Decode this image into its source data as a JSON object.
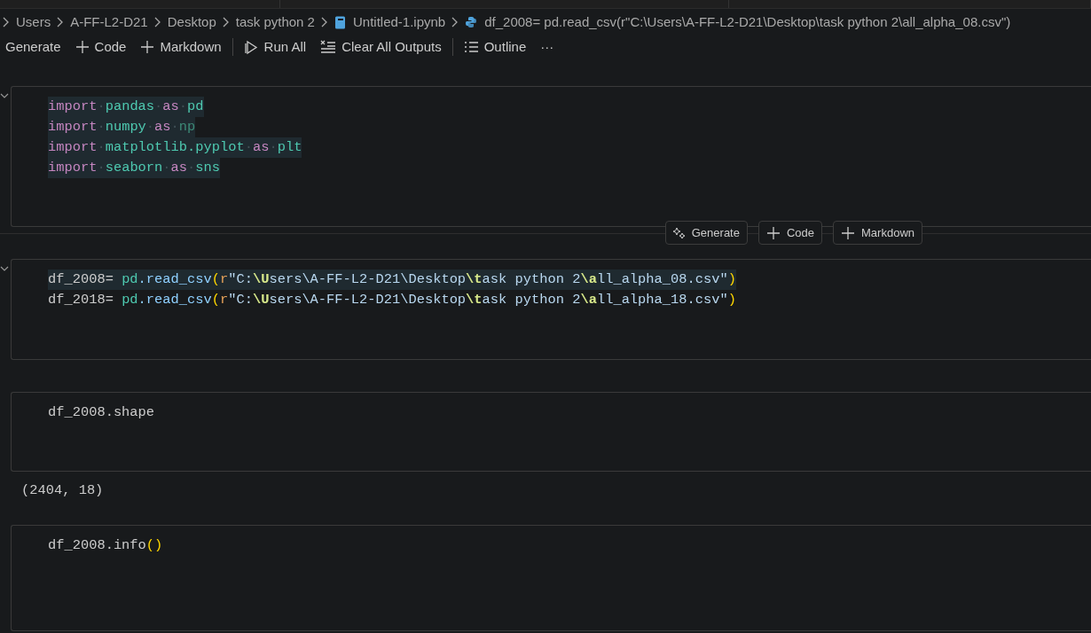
{
  "breadcrumb": [
    {
      "label": "Users"
    },
    {
      "label": "A-FF-L2-D21"
    },
    {
      "label": "Desktop"
    },
    {
      "label": "task python 2"
    },
    {
      "label": "Untitled-1.ipynb",
      "kind": "notebook"
    },
    {
      "label": "df_2008= pd.read_csv(r\"C:\\Users\\A-FF-L2-D21\\Desktop\\task python 2\\all_alpha_08.csv\")",
      "kind": "python"
    }
  ],
  "toolbar": [
    {
      "label": "Generate",
      "kind": "text"
    },
    {
      "label": "Code",
      "kind": "add"
    },
    {
      "label": "Markdown",
      "kind": "add"
    },
    {
      "kind": "separator"
    },
    {
      "label": "Run All",
      "kind": "run"
    },
    {
      "label": "Clear All Outputs",
      "kind": "clear"
    },
    {
      "kind": "separator"
    },
    {
      "label": "Outline",
      "kind": "outline"
    },
    {
      "label": "···",
      "kind": "text"
    }
  ],
  "cells": [
    {
      "collapsible": true,
      "insert_toolbar": [
        {
          "label": "Generate",
          "kind": "generate"
        },
        {
          "label": "Code",
          "kind": "add"
        },
        {
          "label": "Markdown",
          "kind": "add"
        }
      ],
      "lines": [
        {
          "highlighted": true,
          "tokens": [
            {
              "t": "import",
              "kind": "keyword"
            },
            {
              "t": "·",
              "kind": "space"
            },
            {
              "t": "pandas",
              "kind": "module"
            },
            {
              "t": "·",
              "kind": "space"
            },
            {
              "t": "as",
              "kind": "keyword"
            },
            {
              "t": "·",
              "kind": "space"
            },
            {
              "t": "pd",
              "kind": "module"
            }
          ]
        },
        {
          "highlighted": true,
          "tokens": [
            {
              "t": "import",
              "kind": "keyword"
            },
            {
              "t": "·",
              "kind": "space"
            },
            {
              "t": "numpy",
              "kind": "module"
            },
            {
              "t": "·",
              "kind": "space"
            },
            {
              "t": "as",
              "kind": "keyword"
            },
            {
              "t": "·",
              "kind": "space"
            },
            {
              "t": "np",
              "kind": "unused"
            }
          ]
        },
        {
          "highlighted": true,
          "tokens": [
            {
              "t": "import",
              "kind": "keyword"
            },
            {
              "t": "·",
              "kind": "space"
            },
            {
              "t": "matplotlib.pyplot",
              "kind": "module"
            },
            {
              "t": "·",
              "kind": "space"
            },
            {
              "t": "as",
              "kind": "keyword"
            },
            {
              "t": "·",
              "kind": "space"
            },
            {
              "t": "plt",
              "kind": "module"
            }
          ]
        },
        {
          "highlighted": true,
          "tokens": [
            {
              "t": "import",
              "kind": "keyword"
            },
            {
              "t": "·",
              "kind": "space"
            },
            {
              "t": "seaborn",
              "kind": "module"
            },
            {
              "t": "·",
              "kind": "space"
            },
            {
              "t": "as",
              "kind": "keyword"
            },
            {
              "t": "·",
              "kind": "space"
            },
            {
              "t": "sns",
              "kind": "module"
            }
          ]
        }
      ]
    },
    {
      "collapsible": true,
      "lines": [
        {
          "highlighted": true,
          "tokens": [
            {
              "t": "df_2008= ",
              "kind": "plain"
            },
            {
              "t": "pd",
              "kind": "module"
            },
            {
              "t": ".read_csv",
              "kind": "function"
            },
            {
              "t": "(",
              "kind": "paren"
            },
            {
              "t": "r",
              "kind": "prefix"
            },
            {
              "t": "\"C:",
              "kind": "string"
            },
            {
              "t": "\\U",
              "kind": "escape"
            },
            {
              "t": "sers\\A-FF-L2-D21\\Desktop",
              "kind": "string"
            },
            {
              "t": "\\t",
              "kind": "escape"
            },
            {
              "t": "ask python 2",
              "kind": "string"
            },
            {
              "t": "\\a",
              "kind": "escape"
            },
            {
              "t": "ll_alpha_08.csv\"",
              "kind": "string"
            },
            {
              "t": ")",
              "kind": "paren"
            }
          ]
        },
        {
          "highlighted": false,
          "tokens": [
            {
              "t": "df_2018= ",
              "kind": "plain"
            },
            {
              "t": "pd",
              "kind": "module"
            },
            {
              "t": ".read_csv",
              "kind": "function"
            },
            {
              "t": "(",
              "kind": "paren"
            },
            {
              "t": "r",
              "kind": "prefix"
            },
            {
              "t": "\"C:",
              "kind": "string"
            },
            {
              "t": "\\U",
              "kind": "escape"
            },
            {
              "t": "sers\\A-FF-L2-D21\\Desktop",
              "kind": "string"
            },
            {
              "t": "\\t",
              "kind": "escape"
            },
            {
              "t": "ask python 2",
              "kind": "string"
            },
            {
              "t": "\\a",
              "kind": "escape"
            },
            {
              "t": "ll_alpha_18.csv\"",
              "kind": "string"
            },
            {
              "t": ")",
              "kind": "paren"
            }
          ]
        }
      ]
    },
    {
      "collapsible": false,
      "output": "(2404, 18)",
      "lines": [
        {
          "highlighted": false,
          "tokens": [
            {
              "t": "df_2008.shape",
              "kind": "plain"
            }
          ]
        }
      ]
    },
    {
      "collapsible": false,
      "lines": [
        {
          "highlighted": false,
          "tokens": [
            {
              "t": "df_2008.info",
              "kind": "plain"
            },
            {
              "t": "()",
              "kind": "paren"
            }
          ]
        }
      ]
    }
  ]
}
